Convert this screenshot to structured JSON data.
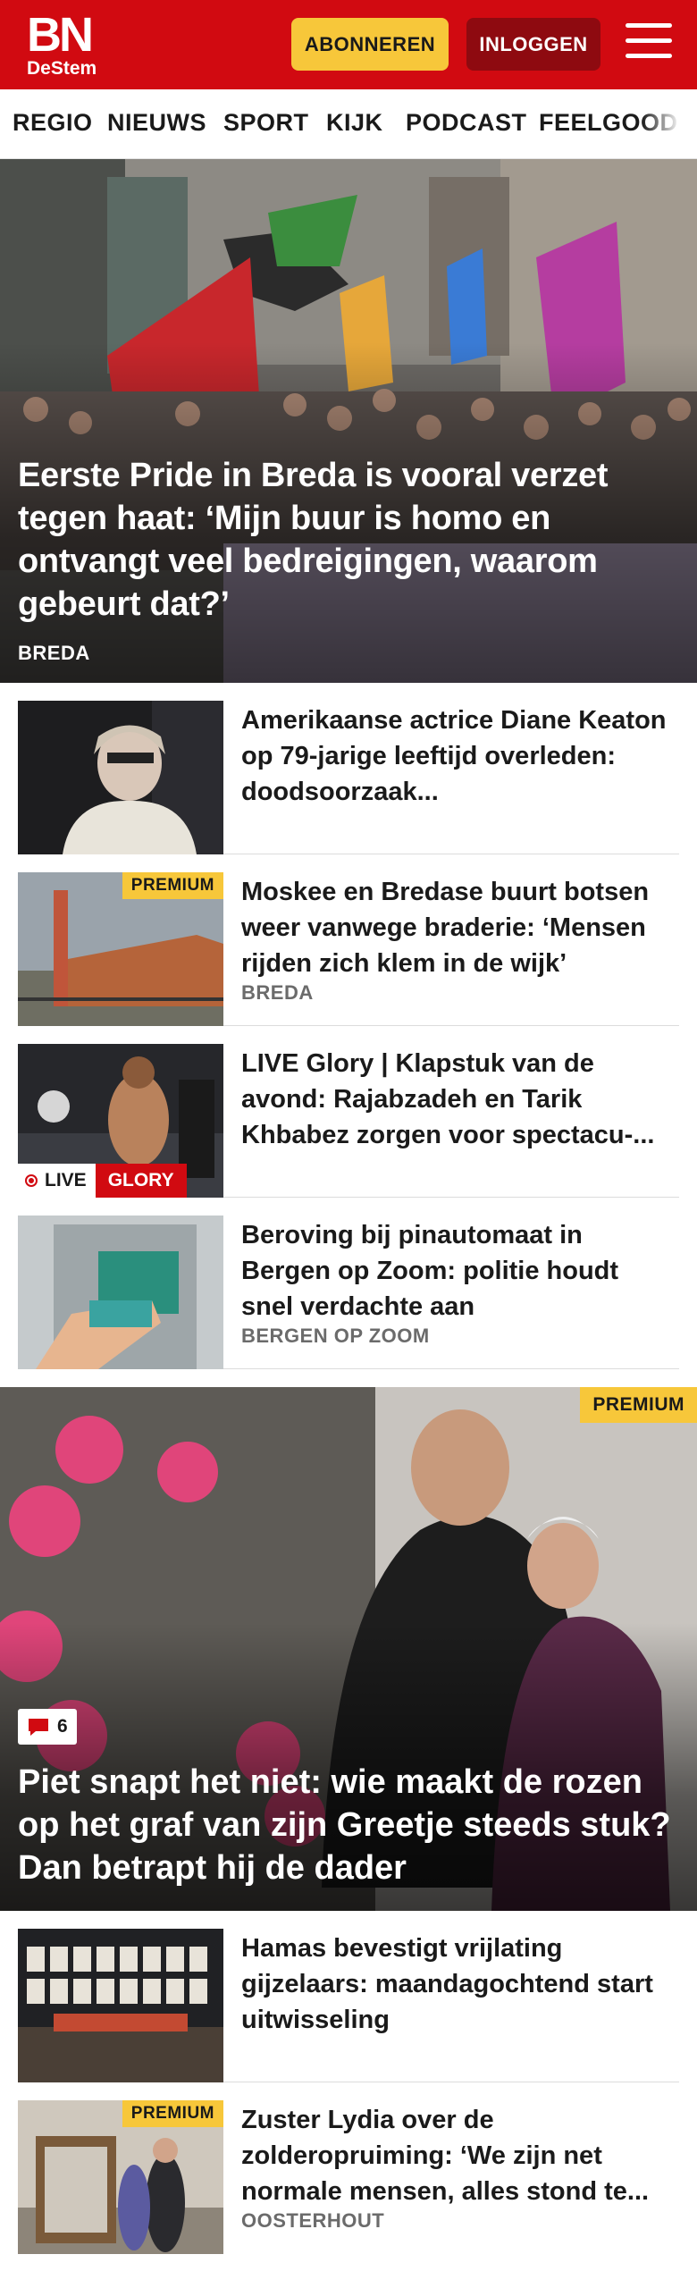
{
  "header": {
    "logo_main": "BN",
    "logo_sub": "DeStem",
    "subscribe_label": "ABONNEREN",
    "login_label": "INLOGGEN",
    "brand_color": "#d10a11",
    "menu_icon": "hamburger-icon"
  },
  "nav": {
    "items": [
      "REGIO",
      "NIEUWS",
      "SPORT",
      "KIJK",
      "PODCAST",
      "FEELGOOD"
    ]
  },
  "hero": {
    "title": "Eerste Pride in Breda is vooral verzet tegen haat: ‘Mijn buur is homo en ontvangt veel bedreigingen, waarom gebeurt dat?’",
    "location": "BREDA"
  },
  "articles": [
    {
      "title": "Amerikaanse actrice Diane Keaton op 79-jarige leeftijd overleden: doodsoorzaak...",
      "location": ""
    },
    {
      "title": "Moskee en Bredase buurt botsen weer vanwege braderie: ‘Mensen rijden zich klem in de wijk’",
      "location": "BREDA",
      "badge": "PREMIUM"
    },
    {
      "title": "LIVE Glory | Klapstuk van de avond: Rajabzadeh en Tarik Khbabez zorgen voor spectacu-...",
      "location": "",
      "live_label": "LIVE",
      "live_tag": "GLORY"
    },
    {
      "title": "Beroving bij pinautomaat in Bergen op Zoom: politie houdt snel verdachte aan",
      "location": "BERGEN OP ZOOM"
    }
  ],
  "feature": {
    "title": "Piet snapt het niet: wie maakt de rozen op het graf van zijn Greetje steeds stuk? Dan betrapt hij de dader",
    "badge": "PREMIUM",
    "comment_count": "6"
  },
  "articles2": [
    {
      "title": "Hamas bevestigt vrijlating gijzelaars: maandagochtend start uitwisseling",
      "location": ""
    },
    {
      "title": "Zuster Lydia over de zolderopruiming: ‘We zijn net normale mensen, alles stond te...",
      "location": "OOSTERHOUT",
      "badge": "PREMIUM"
    }
  ],
  "colors": {
    "premium": "#f7c73a",
    "login_bg": "#8e0a10",
    "meta_text": "#6b6b6b"
  }
}
